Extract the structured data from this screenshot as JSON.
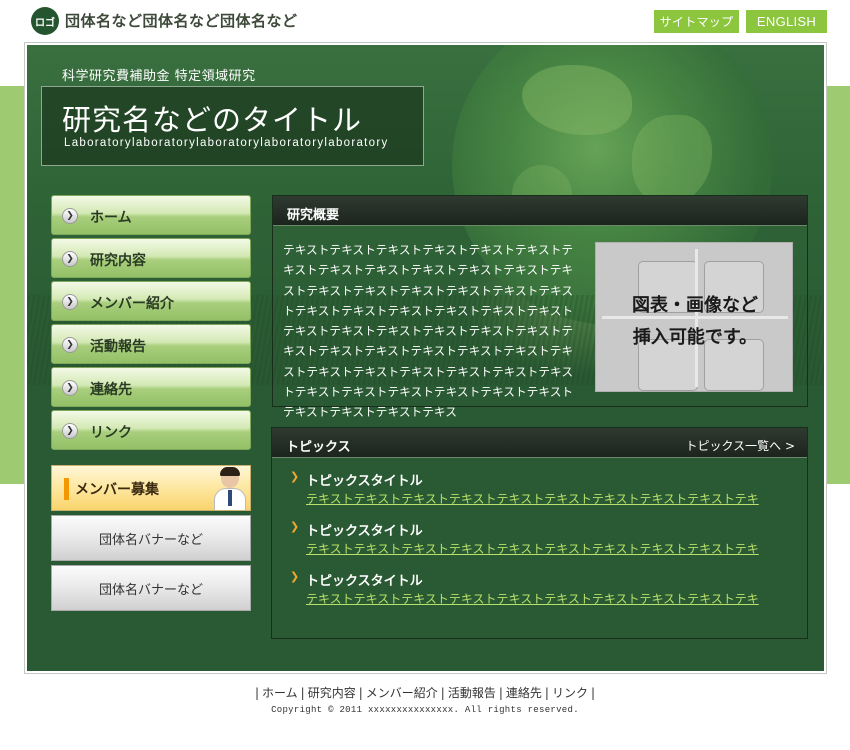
{
  "header": {
    "logo": "ロゴ",
    "org_name": "団体名など団体名など団体名など",
    "sitemap": "サイトマップ",
    "english": "ENGLISH"
  },
  "hero": {
    "subtitle": "科学研究費補助金 特定領域研究",
    "title": "研究名などのタイトル",
    "lab": "Laboratorylaboratorylaboratorylaboratorylaboratory"
  },
  "nav": {
    "items": [
      {
        "label": "ホーム"
      },
      {
        "label": "研究内容"
      },
      {
        "label": "メンバー紹介"
      },
      {
        "label": "活動報告"
      },
      {
        "label": "連絡先"
      },
      {
        "label": "リンク"
      }
    ]
  },
  "banners": {
    "recruit": "メンバー募集",
    "org1": "団体名バナーなど",
    "org2": "団体名バナーなど"
  },
  "research": {
    "heading": "研究概要",
    "text": "テキストテキストテキストテキストテキストテキストテキストテキストテキストテキストテキストテキストテキストテキストテキストテキストテキストテキストテキストテキストテキストテキストテキストテキストテキストテキストテキストテキストテキストテキストテキストテキストテキストテキストテキストテキストテキストテキストテキストテキストテキストテキストテキストテキストテキストテキストテキストテキストテキストテキストテキストテキストテキストテキス",
    "figure_line1": "図表・画像など",
    "figure_line2": "挿入可能です。"
  },
  "topics": {
    "heading": "トピックス",
    "more": "トピックス一覧へ >",
    "items": [
      {
        "title": "トピックスタイトル",
        "link": "テキストテキストテキストテキストテキストテキストテキストテキストテキストテキ"
      },
      {
        "title": "トピックスタイトル",
        "link": "テキストテキストテキストテキストテキストテキストテキストテキストテキストテキ"
      },
      {
        "title": "トピックスタイトル",
        "link": "テキストテキストテキストテキストテキストテキストテキストテキストテキストテキ"
      }
    ]
  },
  "footer": {
    "links": [
      "ホーム",
      "研究内容",
      "メンバー紹介",
      "活動報告",
      "連絡先",
      "リンク"
    ],
    "copyright": "Copyright © 2011 xxxxxxxxxxxxxxx. All rights reserved."
  },
  "colors": {
    "accent_green": "#8cc63f",
    "main_bg": "#2a5a33",
    "link_green": "#b8e06a",
    "topic_chevron": "#f0a830"
  }
}
